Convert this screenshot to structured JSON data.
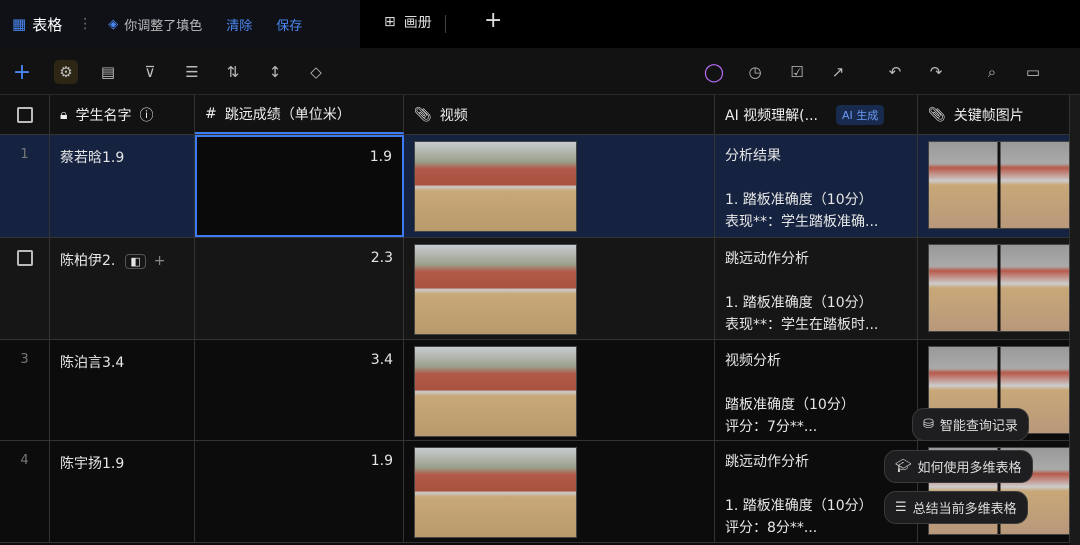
{
  "tabs": {
    "table": "表格",
    "fill_note": "你调整了填色",
    "clear": "清除",
    "save": "保存",
    "gallery": "画册"
  },
  "columns": {
    "name": "学生名字",
    "score": "跳远成绩（单位米）",
    "video": "视频",
    "ai": "AI 视频理解(...",
    "ai_badge": "AI 生成",
    "keyframe": "关键帧图片"
  },
  "rows": [
    {
      "num": "1",
      "name": "蔡若晗1.9",
      "score": "1.9",
      "ai_title": "分析结果",
      "ai_l1": "1. 踏板准确度（10分）",
      "ai_l2": "表现**：学生踏板准确..."
    },
    {
      "num": "",
      "name": "陈柏伊2.",
      "score": "2.3",
      "ai_title": "跳远动作分析",
      "ai_l1": "1. 踏板准确度（10分）",
      "ai_l2": "表现**：学生在踏板时..."
    },
    {
      "num": "3",
      "name": "陈泊言3.4",
      "score": "3.4",
      "ai_title": "视频分析",
      "ai_l1": "踏板准确度（10分）",
      "ai_l2": "评分：7分**..."
    },
    {
      "num": "4",
      "name": "陈宇扬1.9",
      "score": "1.9",
      "ai_title": "跳远动作分析",
      "ai_l1": "1. 踏板准确度（10分）",
      "ai_l2": "评分：8分**..."
    }
  ],
  "suggestions": [
    "智能查询记录",
    "如何使用多维表格",
    "总结当前多维表格"
  ],
  "colors": {
    "accent": "#3d7bf5",
    "selected_row": "#162340"
  }
}
